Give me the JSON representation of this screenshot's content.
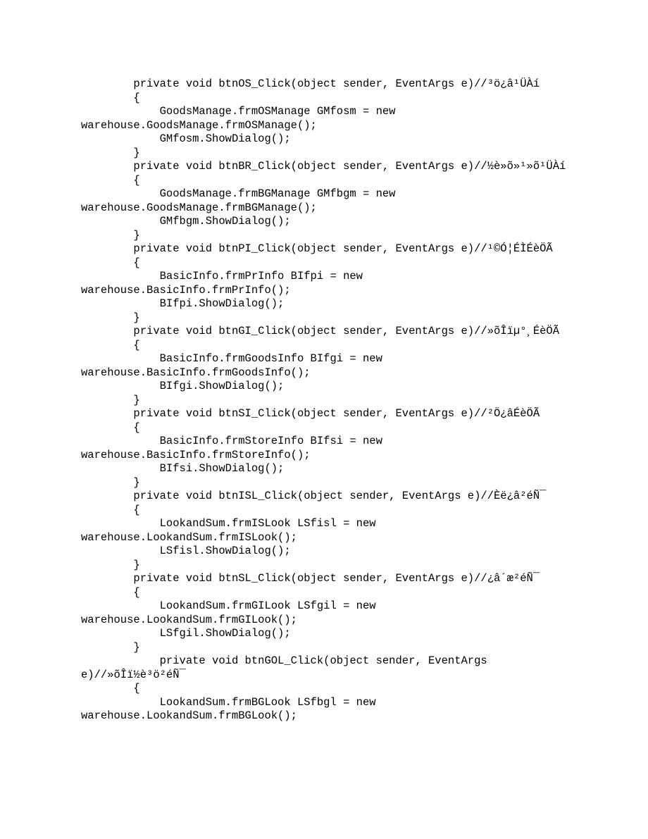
{
  "code": {
    "text": "        private void btnOS_Click(object sender, EventArgs e)//³ö¿â¹ÜÀí\n        {\n            GoodsManage.frmOSManage GMfosm = new warehouse.GoodsManage.frmOSManage();\n            GMfosm.ShowDialog();\n        }\n        private void btnBR_Click(object sender, EventArgs e)//½è»õ»¹»õ¹ÜÀí\n        {\n            GoodsManage.frmBGManage GMfbgm = new warehouse.GoodsManage.frmBGManage();\n            GMfbgm.ShowDialog();\n        }\n        private void btnPI_Click(object sender, EventArgs e)//¹©Ó¦ÉÌÉèÖÃ\n        {\n            BasicInfo.frmPrInfo BIfpi = new warehouse.BasicInfo.frmPrInfo();\n            BIfpi.ShowDialog();\n        }\n        private void btnGI_Click(object sender, EventArgs e)//»õÎïµ°¸ÉèÖÃ\n        {\n            BasicInfo.frmGoodsInfo BIfgi = new warehouse.BasicInfo.frmGoodsInfo();\n            BIfgi.ShowDialog();\n        }\n        private void btnSI_Click(object sender, EventArgs e)//²Ö¿âÉèÖÃ\n        {\n            BasicInfo.frmStoreInfo BIfsi = new warehouse.BasicInfo.frmStoreInfo();\n            BIfsi.ShowDialog();\n        }\n        private void btnISL_Click(object sender, EventArgs e)//Èë¿â²éÑ¯\n        {\n            LookandSum.frmISLook LSfisl = new warehouse.LookandSum.frmISLook();\n            LSfisl.ShowDialog();\n        }\n        private void btnSL_Click(object sender, EventArgs e)//¿â´æ²éÑ¯\n        {\n            LookandSum.frmGILook LSfgil = new warehouse.LookandSum.frmGILook();\n            LSfgil.ShowDialog();\n        }\n            private void btnGOL_Click(object sender, EventArgs e)//»õÎï½è³ö²éÑ¯\n        {\n            LookandSum.frmBGLook LSfbgl = new warehouse.LookandSum.frmBGLook();"
  }
}
